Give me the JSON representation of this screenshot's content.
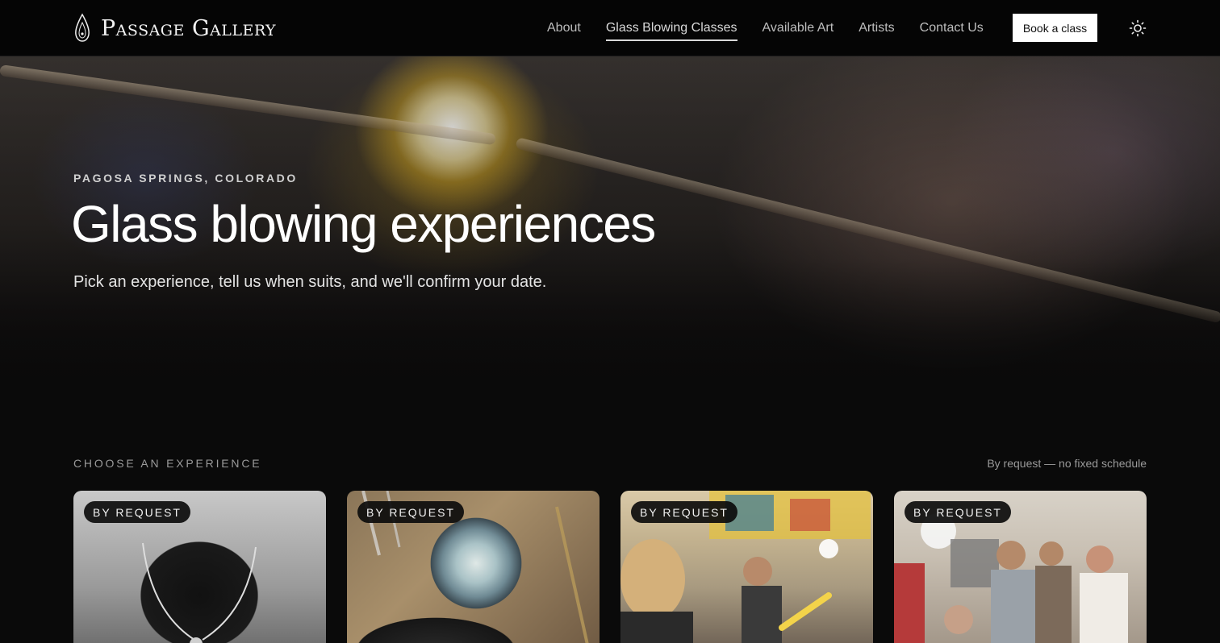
{
  "brand": {
    "name": "Passage Gallery",
    "logo_icon": "flame-drop-icon"
  },
  "nav": {
    "links": [
      {
        "label": "About"
      },
      {
        "label": "Glass Blowing Classes",
        "active": true
      },
      {
        "label": "Available Art"
      },
      {
        "label": "Artists"
      },
      {
        "label": "Contact Us"
      }
    ],
    "book_label": "Book a class",
    "theme_icon": "sun-icon"
  },
  "hero": {
    "eyebrow": "PAGOSA SPRINGS, COLORADO",
    "title": "Glass blowing experiences",
    "subtitle": "Pick an experience, tell us when suits, and we'll confirm your date."
  },
  "experiences": {
    "heading": "CHOOSE AN EXPERIENCE",
    "note": "By request — no fixed schedule",
    "cards": [
      {
        "badge": "BY REQUEST",
        "image": "pendant-necklace-photo"
      },
      {
        "badge": "BY REQUEST",
        "image": "glass-marble-photo"
      },
      {
        "badge": "BY REQUEST",
        "image": "studio-demo-photo"
      },
      {
        "badge": "BY REQUEST",
        "image": "class-group-photo"
      }
    ]
  },
  "colors": {
    "background": "#0a0a0a",
    "nav_bg": "#050505",
    "button_bg": "#ffffff"
  }
}
